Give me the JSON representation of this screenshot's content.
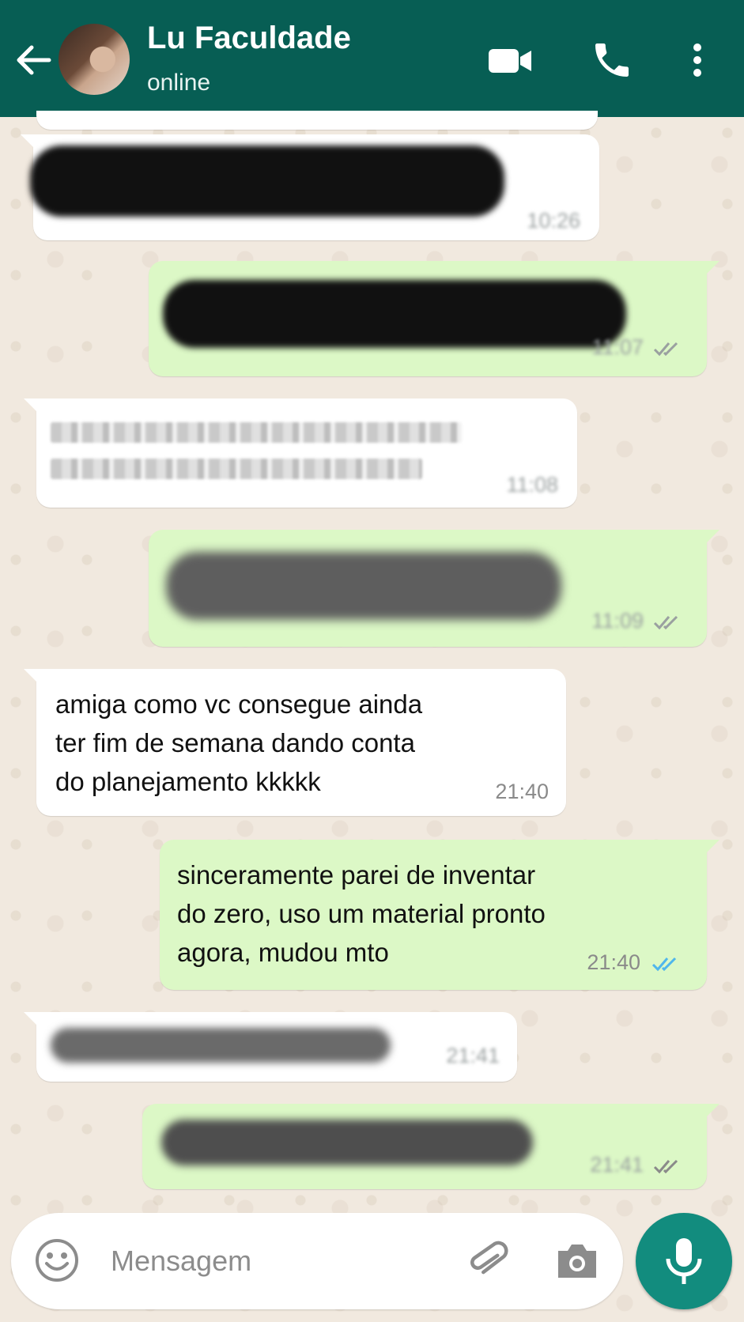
{
  "header": {
    "contact_name": "Lu Faculdade",
    "status": "online",
    "bg_color": "#075e54"
  },
  "messages": [
    {
      "direction": "incoming",
      "redacted": true,
      "time": "10:26"
    },
    {
      "direction": "outgoing",
      "redacted": true,
      "time": "11:07",
      "read": true
    },
    {
      "direction": "incoming",
      "redacted": true,
      "time": "11:08"
    },
    {
      "direction": "outgoing",
      "redacted": true,
      "time": "11:09",
      "read": true
    },
    {
      "direction": "incoming",
      "text": "amiga como vc consegue ainda\nter fim de semana dando conta\ndo planejamento kkkkk",
      "time": "21:40"
    },
    {
      "direction": "outgoing",
      "text": "sinceramente parei de inventar\ndo zero, uso um material pronto\nagora, mudou mto",
      "time": "21:40",
      "read": true,
      "tick_color": "#4fb6ec"
    },
    {
      "direction": "incoming",
      "redacted": true,
      "time": "21:41"
    },
    {
      "direction": "outgoing",
      "redacted": true,
      "time": "21:41",
      "read": true
    }
  ],
  "composer": {
    "placeholder": "Mensagem"
  },
  "icons": {
    "back": "arrow-left-icon",
    "video": "video-camera-icon",
    "call": "phone-icon",
    "menu": "more-vertical-icon",
    "emoji": "emoji-icon",
    "attach": "paperclip-icon",
    "camera": "camera-icon",
    "mic": "microphone-icon"
  },
  "colors": {
    "incoming_bubble": "#ffffff",
    "outgoing_bubble": "#dcf8c6",
    "mic_button": "#128c7e"
  }
}
